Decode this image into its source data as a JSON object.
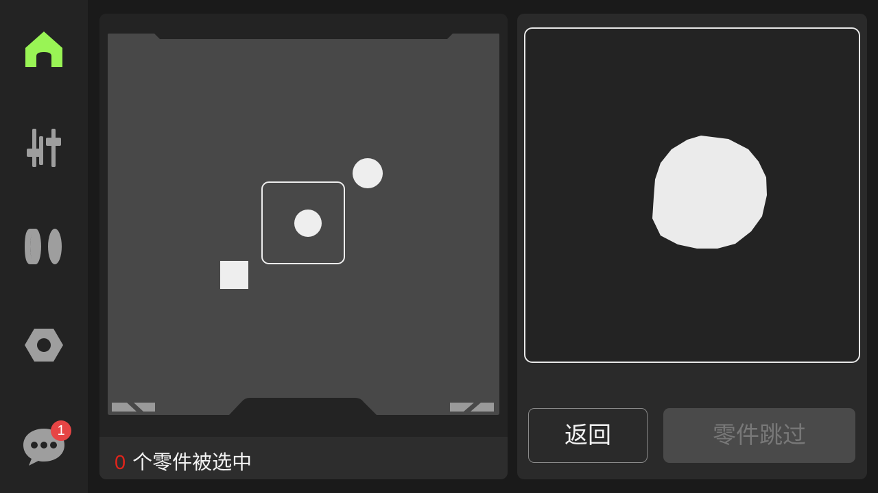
{
  "sidebar": {
    "items": [
      {
        "name": "home",
        "icon": "home-icon",
        "color": "#99f455",
        "active": true
      },
      {
        "name": "controls",
        "icon": "sliders-icon",
        "color": "#9e9e9e"
      },
      {
        "name": "filament",
        "icon": "filament-spool-icon",
        "color": "#9e9e9e"
      },
      {
        "name": "settings",
        "icon": "hex-nut-icon",
        "color": "#9e9e9e"
      },
      {
        "name": "messages",
        "icon": "chat-bubble-icon",
        "color": "#9e9e9e",
        "badge": "1"
      }
    ]
  },
  "plate": {
    "objects": [
      {
        "shape": "circle",
        "selected": false
      },
      {
        "shape": "circle",
        "selected": true
      },
      {
        "shape": "square",
        "selected": false
      }
    ]
  },
  "status": {
    "count": "0",
    "text": "个零件被选中"
  },
  "preview": {
    "shape": "circle"
  },
  "buttons": {
    "back_label": "返回",
    "skip_label": "零件跳过"
  },
  "colors": {
    "accent": "#99f455",
    "badge": "#e64545",
    "count": "#e0241b"
  }
}
